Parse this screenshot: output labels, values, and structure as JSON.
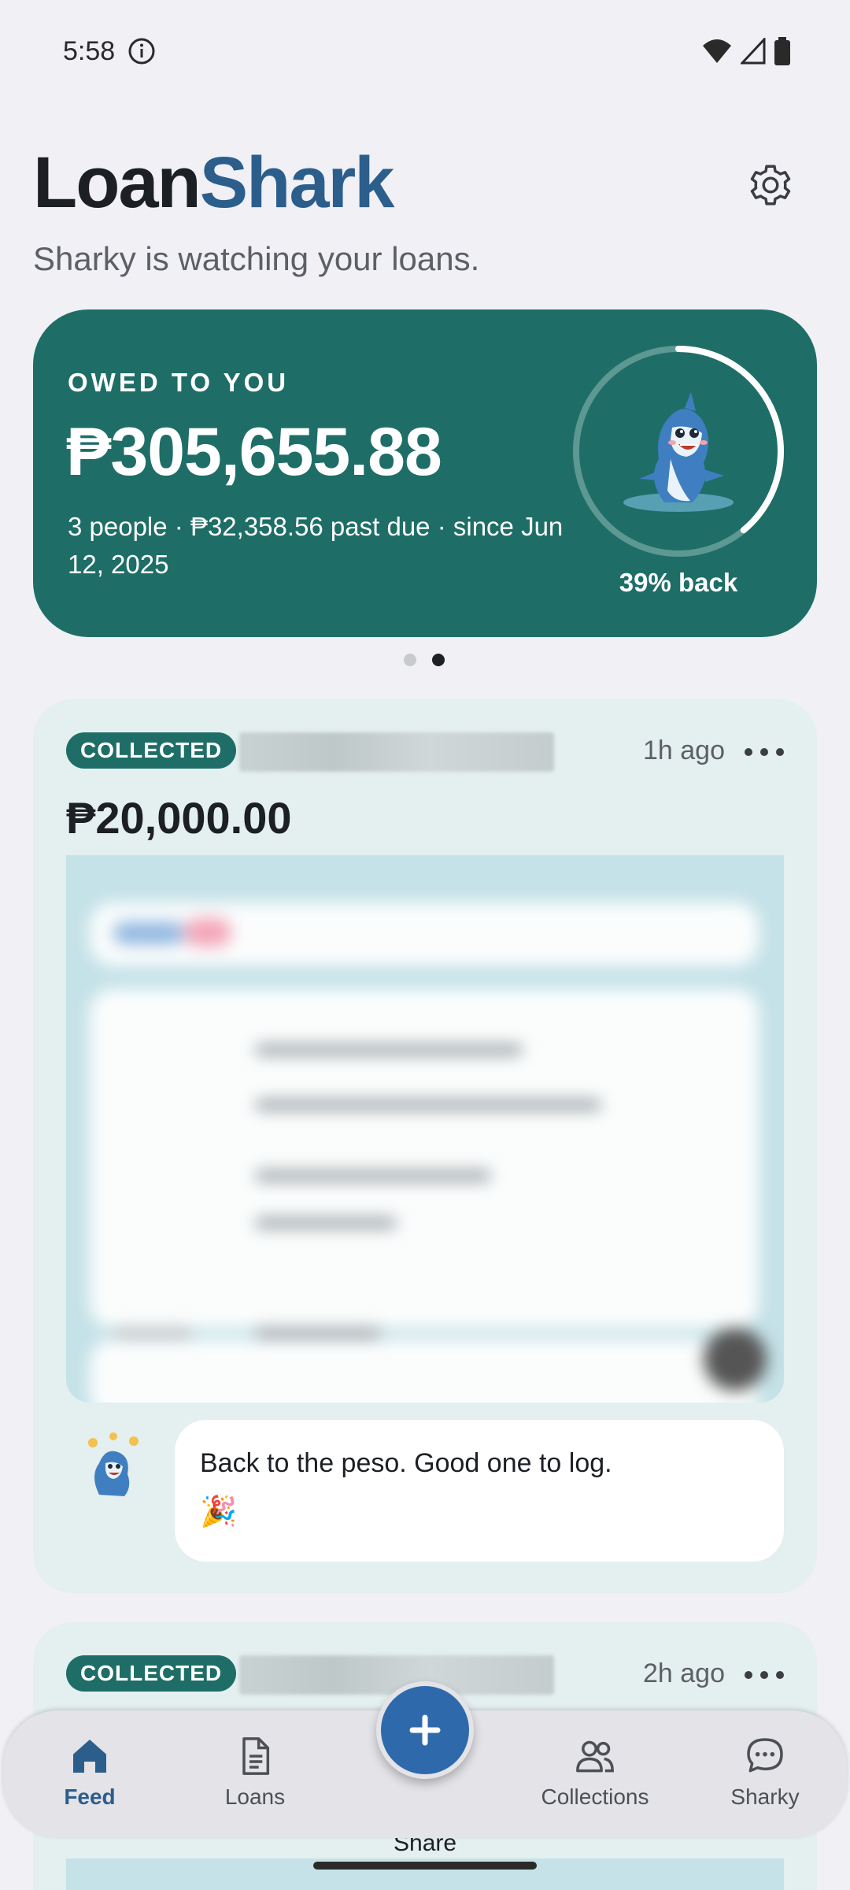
{
  "status_bar": {
    "time": "5:58"
  },
  "header": {
    "title_part1": "Loan",
    "title_part2": "Shark",
    "tagline": "Sharky is watching your loans."
  },
  "summary": {
    "label": "OWED TO YOU",
    "amount": "₱305,655.88",
    "details": "3 people · ₱32,358.56 past due · since Jun 12, 2025",
    "progress_label": "39% back",
    "progress_fraction": 0.39
  },
  "pager": {
    "pages": 2,
    "active_index": 1
  },
  "feed": [
    {
      "badge": "COLLECTED",
      "time_ago": "1h ago",
      "amount": "₱20,000.00",
      "message": "Back to the peso. Good one to log.",
      "emoji": "🎉"
    },
    {
      "badge": "COLLECTED",
      "time_ago": "2h ago"
    }
  ],
  "nav": {
    "items": [
      {
        "label": "Feed",
        "icon": "home-icon",
        "active": true
      },
      {
        "label": "Loans",
        "icon": "document-icon",
        "active": false
      },
      {
        "label": "Collections",
        "icon": "people-icon",
        "active": false
      },
      {
        "label": "Sharky",
        "icon": "chat-icon",
        "active": false
      }
    ],
    "fab_icon": "plus-icon"
  },
  "peek": {
    "text": "Share"
  },
  "colors": {
    "brand_teal": "#1e6e67",
    "brand_blue": "#2c5e8c",
    "fab_blue": "#2e6aab",
    "background": "#f0f0f5",
    "card_bg": "#e4efef"
  }
}
